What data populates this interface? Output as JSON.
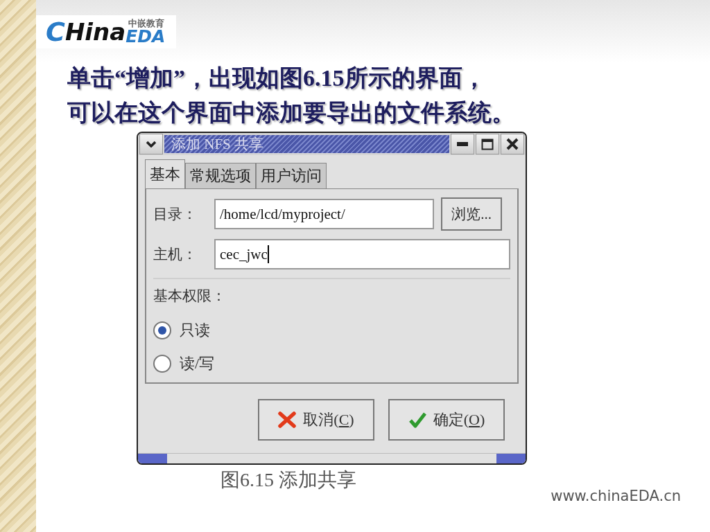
{
  "logo": {
    "letter": "C",
    "name": "Hina",
    "suffix": "EDA",
    "tagline": "中嵌教育"
  },
  "heading": [
    "单击“增加”，出现如图6.15所示的界面，",
    "可以在这个界面中添加要导出的文件系统。"
  ],
  "dialog": {
    "title": "添加 NFS 共享",
    "tabs": [
      {
        "label": "基本",
        "selected": true
      },
      {
        "label": "常规选项",
        "selected": false
      },
      {
        "label": "用户访问",
        "selected": false
      }
    ],
    "directory": {
      "label": "目录：",
      "value": "/home/lcd/myproject/",
      "browse": "浏览..."
    },
    "host": {
      "label": "主机：",
      "value": "cec_jwc"
    },
    "permissions": {
      "label": "基本权限：",
      "options": [
        {
          "label": "只读",
          "selected": true
        },
        {
          "label": "读/写",
          "selected": false
        }
      ]
    },
    "buttons": [
      {
        "kind": "cancel",
        "label": "取消(",
        "mnemonic": "C",
        "label_end": ")"
      },
      {
        "kind": "ok",
        "label": "确定(",
        "mnemonic": "O",
        "label_end": ")"
      }
    ]
  },
  "caption": "图6.15  添加共享",
  "url": "www.chinaEDA.cn"
}
